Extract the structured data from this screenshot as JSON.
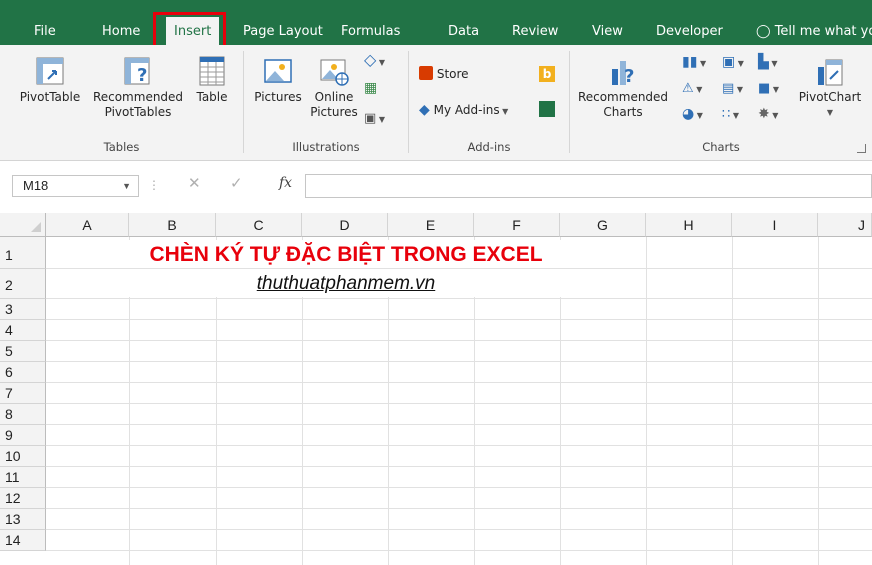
{
  "tabs": {
    "file": "File",
    "home": "Home",
    "insert": "Insert",
    "page_layout": "Page Layout",
    "formulas": "Formulas",
    "data": "Data",
    "review": "Review",
    "view": "View",
    "developer": "Developer",
    "tell_me": "Tell me what yo"
  },
  "ribbon": {
    "tables": {
      "label": "Tables",
      "pivottable": "PivotTable",
      "recommended_line1": "Recommended",
      "recommended_line2": "PivotTables",
      "table": "Table"
    },
    "illustrations": {
      "label": "Illustrations",
      "pictures": "Pictures",
      "online_line1": "Online",
      "online_line2": "Pictures"
    },
    "addins": {
      "label": "Add-ins",
      "store": "Store",
      "my_addins": "My Add-ins"
    },
    "charts": {
      "label": "Charts",
      "recommended_line1": "Recommended",
      "recommended_line2": "Charts",
      "pivotchart": "PivotChart"
    }
  },
  "formula_bar": {
    "name_box": "M18",
    "fx": "fx",
    "value": ""
  },
  "columns": [
    "A",
    "B",
    "C",
    "D",
    "E",
    "F",
    "G",
    "H",
    "I",
    "J"
  ],
  "rows": [
    "1",
    "2",
    "3",
    "4",
    "5",
    "6",
    "7",
    "8",
    "9",
    "10",
    "11",
    "12",
    "13",
    "14"
  ],
  "cells": {
    "title": "CHÈN KÝ TỰ ĐẶC BIỆT TRONG EXCEL",
    "link": "thuthuatphanmem.vn"
  },
  "colors": {
    "accent": "#217346",
    "highlight": "#e8000b"
  }
}
